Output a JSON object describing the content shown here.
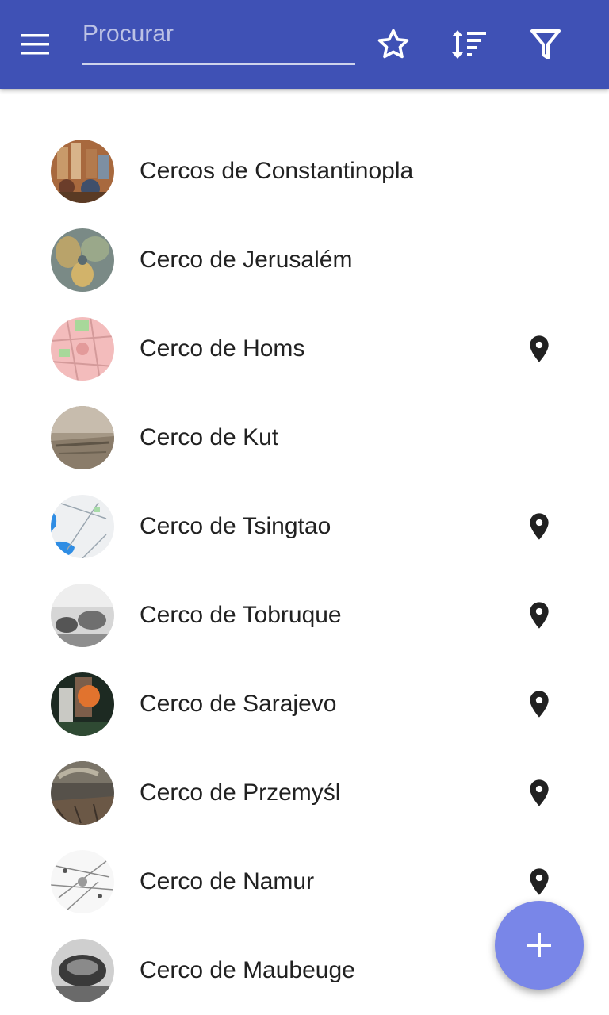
{
  "appbar": {
    "background": "#3f51b5",
    "menu_icon": "menu-icon",
    "search": {
      "placeholder": "Procurar",
      "value": ""
    },
    "actions": [
      "star-outline-icon",
      "sort-icon",
      "filter-icon"
    ]
  },
  "list": {
    "items": [
      {
        "label": "Cercos de Constantinopla",
        "has_location": false
      },
      {
        "label": "Cerco de Jerusalém",
        "has_location": false
      },
      {
        "label": "Cerco de Homs",
        "has_location": true
      },
      {
        "label": "Cerco de Kut",
        "has_location": false
      },
      {
        "label": "Cerco de Tsingtao",
        "has_location": true
      },
      {
        "label": "Cerco de Tobruque",
        "has_location": true
      },
      {
        "label": "Cerco de Sarajevo",
        "has_location": true
      },
      {
        "label": "Cerco de Przemyśl",
        "has_location": true
      },
      {
        "label": "Cerco de Namur",
        "has_location": true
      },
      {
        "label": "Cerco de Maubeuge",
        "has_location": false
      }
    ]
  },
  "fab": {
    "icon": "add-icon",
    "color": "#7986e8"
  }
}
